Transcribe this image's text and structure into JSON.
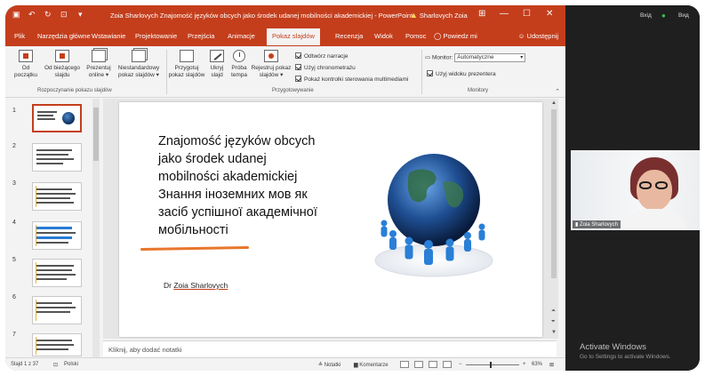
{
  "titlebar": {
    "document_title": "Zoia Sharlovych Znajomość języków obcych jako środek udanej mobilności akademickiej  -  PowerPoint",
    "user_warning": "Sharlovych Zoia",
    "accent_color": "#c43e1c"
  },
  "tabs": [
    {
      "label": "Plik"
    },
    {
      "label": "Narzędzia główne"
    },
    {
      "label": "Wstawianie"
    },
    {
      "label": "Projektowanie"
    },
    {
      "label": "Przejścia"
    },
    {
      "label": "Animacje"
    },
    {
      "label": "Pokaz slajdów",
      "active": true
    },
    {
      "label": "Recenzja"
    },
    {
      "label": "Widok"
    },
    {
      "label": "Pomoc"
    },
    {
      "label": "Powiedz mi"
    }
  ],
  "share_label": "Udostępnij",
  "ribbon": {
    "start_group": {
      "buttons": [
        {
          "line1": "Od",
          "line2": "początku"
        },
        {
          "line1": "Od bieżącego",
          "line2": "slajdu"
        },
        {
          "line1": "Prezentuj",
          "line2": "online ▾"
        },
        {
          "line1": "Niestandardowy",
          "line2": "pokaz slajdów ▾"
        }
      ],
      "label": "Rozpoczynanie pokazu slajdów"
    },
    "setup_group": {
      "buttons": [
        {
          "line1": "Przygotuj",
          "line2": "pokaz slajdów"
        },
        {
          "line1": "Ukryj",
          "line2": "slajd"
        },
        {
          "line1": "Próba",
          "line2": "tempa"
        },
        {
          "line1": "Rejestruj pokaz",
          "line2": "slajdów ▾"
        }
      ],
      "checkboxes": [
        {
          "label": "Odtwórz narracje",
          "checked": true
        },
        {
          "label": "Użyj chronometrażu",
          "checked": true
        },
        {
          "label": "Pokaż kontrolki sterowania multimediami",
          "checked": true
        }
      ],
      "label": "Przygotowywanie"
    },
    "monitors_group": {
      "monitor_label": "Monitor:",
      "monitor_value": "Automatyczne",
      "presenter_view": {
        "label": "Użyj widoku prezentera",
        "checked": true
      },
      "label": "Monitory"
    }
  },
  "thumbnails": [
    "1",
    "2",
    "3",
    "4",
    "5",
    "6",
    "7"
  ],
  "slide": {
    "title_lines": [
      "Znajomość języków obcych",
      "jako środek udanej",
      "mobilności akademickiej",
      "Знання іноземних мов як",
      "засіб успішної академічної",
      "мобільності"
    ],
    "author_prefix": "Dr ",
    "author_name": "Zoia Sharlovych"
  },
  "notes_placeholder": "Kliknij, aby dodać notatki",
  "statusbar": {
    "slide_count": "Slajd 1 z 37",
    "language": "Polski",
    "notes_label": "Notatki",
    "comments_label": "Komentarze",
    "zoom": "63%"
  },
  "video": {
    "top_left": "Вхід",
    "top_right": "Вид",
    "participant_name": "Zoia Sharlovych",
    "activation_title": "Activate Windows",
    "activation_sub": "Go to Settings to activate Windows."
  }
}
